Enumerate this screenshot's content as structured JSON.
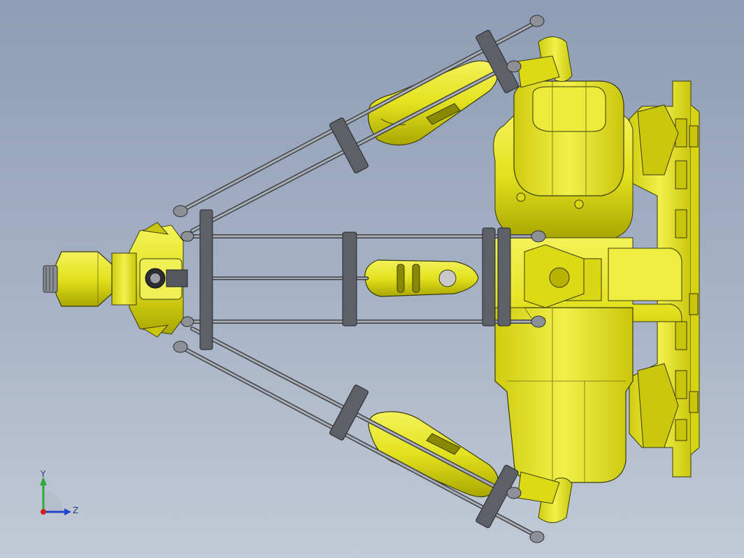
{
  "view": {
    "title": "",
    "background_top": "#8e9db5",
    "background_bottom": "#c2cad6",
    "part_color": "#e3e21e",
    "part_shadow": "#b8b400",
    "rod_color": "#6f737a",
    "rod_dark": "#43464b"
  },
  "triad": {
    "y_label": "Y",
    "z_label": "Z",
    "y_color": "#2faa3b",
    "z_color": "#2346c8",
    "x_color": "#d02020"
  }
}
